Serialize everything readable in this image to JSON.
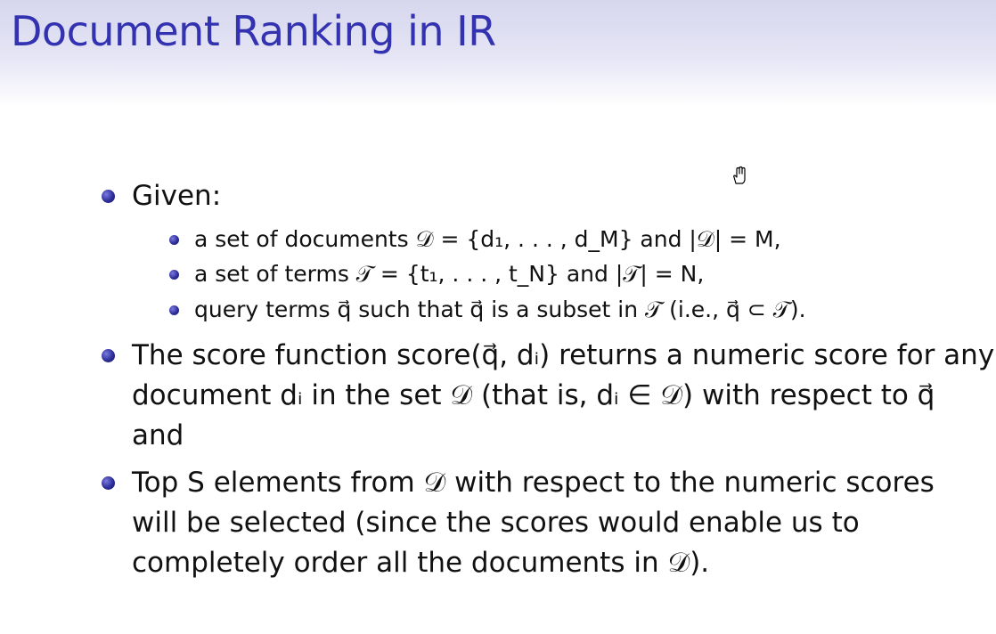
{
  "slide": {
    "title": "Document Ranking in IR",
    "bullets": [
      {
        "lines": [
          "Given:"
        ],
        "sub": [
          "a set of documents 𝒟 = {d₁, . . . , d_M} and |𝒟| = M,",
          "a set of terms 𝒯 = {t₁, . . . , t_N} and |𝒯| = N,",
          "query terms q⃗ such that q⃗ is a subset in 𝒯 (i.e., q⃗ ⊂ 𝒯)."
        ]
      },
      {
        "lines": [
          "The score function score(q⃗, dᵢ) returns a numeric score for any",
          "document dᵢ in the set 𝒟 (that is, dᵢ ∈ 𝒟) with respect to q⃗",
          "and"
        ]
      },
      {
        "lines": [
          "Top S elements from 𝒟 with respect to the numeric scores",
          "will be selected (since the scores would enable us to",
          "completely order all the documents in 𝒟)."
        ]
      }
    ]
  },
  "colors": {
    "title": "#3333b2",
    "bullet": "#2e2e9a",
    "header_gradient_top": "#d6d6ee"
  },
  "icons": [
    "hand-cursor-icon"
  ]
}
